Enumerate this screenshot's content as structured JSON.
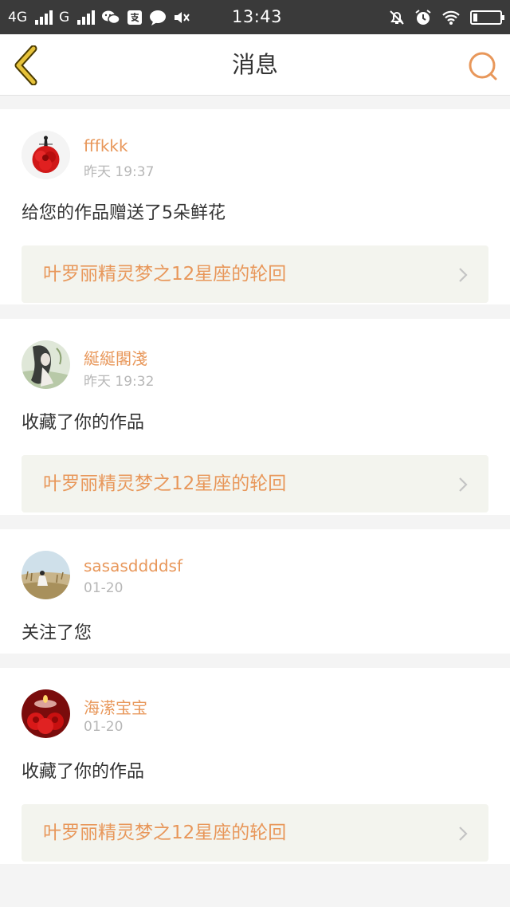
{
  "status_bar": {
    "network_1": "4G",
    "network_2": "G",
    "time": "13:43",
    "battery_level": 0.15,
    "icons": [
      "signal-icon",
      "wechat-icon",
      "alipay-icon",
      "chat-bubble-icon",
      "mute-icon",
      "alarm-off-icon",
      "alarm-clock-icon",
      "wifi-icon",
      "battery-icon"
    ]
  },
  "header": {
    "title": "消息",
    "back_icon": "chevron-left-icon",
    "search_icon": "search-icon",
    "accent_color": "#e8975a",
    "back_icon_color": "#e6c23a"
  },
  "messages": [
    {
      "user": "fffkkk",
      "time": "昨天 19:37",
      "action": "给您的作品赠送了5朵鲜花",
      "work": "叶罗丽精灵梦之12星座的轮回"
    },
    {
      "user": "綖綖閣淺",
      "time": "昨天 19:32",
      "action": "收藏了你的作品",
      "work": "叶罗丽精灵梦之12星座的轮回"
    },
    {
      "user": "sasasddddsf",
      "time": "01-20",
      "action": "关注了您"
    },
    {
      "user": "海潆宝宝",
      "time": "01-20",
      "action": "收藏了你的作品",
      "work": "叶罗丽精灵梦之12星座的轮回"
    }
  ]
}
